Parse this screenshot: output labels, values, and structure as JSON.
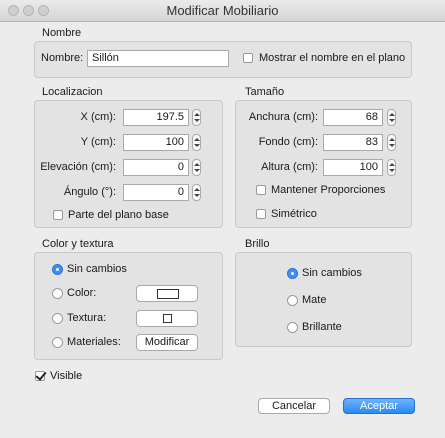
{
  "window": {
    "title": "Modificar Mobiliario"
  },
  "nombre": {
    "section": "Nombre",
    "label": "Nombre:",
    "value": "Sillón",
    "show_label": "Mostrar el nombre en el plano",
    "show_checked": false
  },
  "localizacion": {
    "section": "Localizacion",
    "x_label": "X (cm):",
    "x_value": "197.5",
    "y_label": "Y (cm):",
    "y_value": "100",
    "elev_label": "Elevación (cm):",
    "elev_value": "0",
    "angle_label": "Ángulo (°):",
    "angle_value": "0",
    "base_label": "Parte del plano base",
    "base_checked": false
  },
  "tamano": {
    "section": "Tamaño",
    "width_label": "Anchura (cm):",
    "width_value": "68",
    "depth_label": "Fondo (cm):",
    "depth_value": "83",
    "height_label": "Altura (cm):",
    "height_value": "100",
    "keep_label": "Mantener Proporciones",
    "keep_checked": false,
    "sym_label": "Simétrico",
    "sym_checked": false
  },
  "color": {
    "section": "Color y textura",
    "no_change": "Sin cambios",
    "color": "Color:",
    "texture": "Textura:",
    "materials": "Materiales:",
    "modify_button": "Modificar",
    "selected": "Sin cambios"
  },
  "brillo": {
    "section": "Brillo",
    "no_change": "Sin cambios",
    "matte": "Mate",
    "shiny": "Brillante",
    "selected": "Sin cambios"
  },
  "visible": {
    "label": "Visible",
    "checked": true
  },
  "buttons": {
    "cancel": "Cancelar",
    "accept": "Aceptar"
  },
  "colors": {
    "accent": "#2a8bf2",
    "background": "#ececec",
    "group_bg": "#e3e3e3"
  }
}
